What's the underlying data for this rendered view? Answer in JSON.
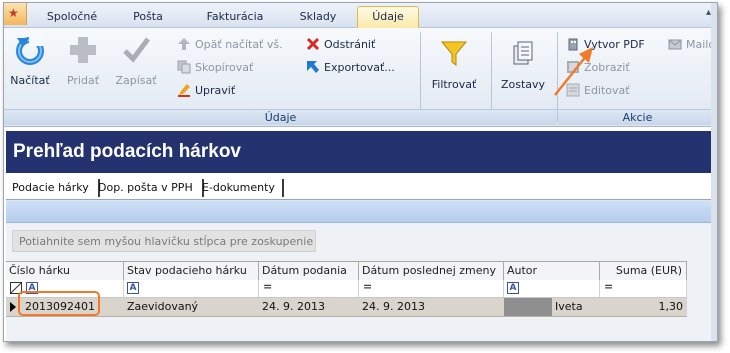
{
  "ribbon_tabs": [
    "Spoločné",
    "Pošta",
    "Fakturácia",
    "Sklady",
    "Údaje"
  ],
  "active_tab": "Údaje",
  "ribbon": {
    "nacitat": "Načítať",
    "pridat": "Pridať",
    "zapisat": "Zapísať",
    "opat_nacitat": "Opäť načítať vš.",
    "skopirovat": "Skopírovať",
    "upravit": "Upraviť",
    "odstranit": "Odstrániť",
    "exportovat": "Exportovať...",
    "filtrovat": "Filtrovať",
    "zostavy": "Zostavy",
    "vytvor_pdf": "Vytvor PDF",
    "zobrazit": "Zobraziť",
    "editovat": "Editovať",
    "mail": "Mailo",
    "group_udaje": "Údaje",
    "group_akcie": "Akcie"
  },
  "page_title": "Prehľad podacích hárkov",
  "subtabs": [
    "Podacie hárky",
    "Dop. pošta v PPH",
    "E-dokumenty"
  ],
  "group_hint": "Potiahnite sem myšou hlavičku stĺpca pre zoskupenie",
  "columns": [
    "Číslo hárku",
    "Stav podacieho hárku",
    "Dátum podania",
    "Dátum poslednej zmeny",
    "Autor",
    "Suma (EUR)"
  ],
  "filter_marks": {
    "a": "A",
    "eq": "="
  },
  "row": {
    "cislo": "2013092401",
    "stav": "Zaevidovaný",
    "datum_podania": "24. 9. 2013",
    "datum_zmeny": "24. 9. 2013",
    "autor": "Iveta",
    "suma": "1,30"
  },
  "colors": {
    "title_bg": "#24326f",
    "highlight": "#f07a2a",
    "active_tab": "#fbe9a8"
  }
}
